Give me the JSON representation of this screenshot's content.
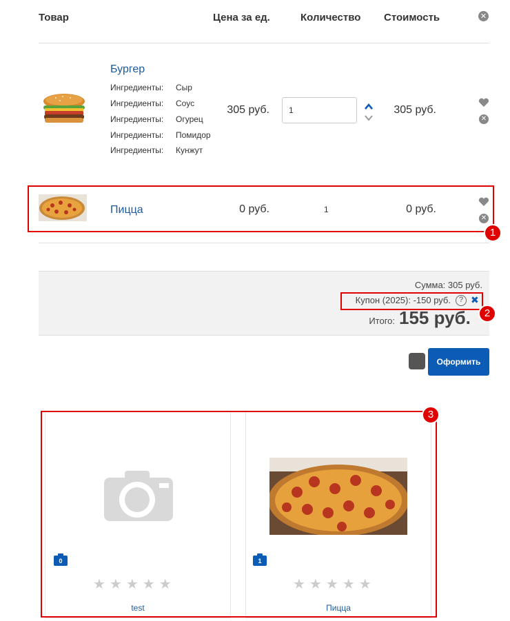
{
  "header": {
    "product": "Товар",
    "price_per_unit": "Цена за ед.",
    "quantity": "Количество",
    "cost": "Стоимость"
  },
  "items": [
    {
      "name": "Бургер",
      "ingredients": [
        {
          "label": "Ингредиенты:",
          "value": "Сыр"
        },
        {
          "label": "Ингредиенты:",
          "value": "Соус"
        },
        {
          "label": "Ингредиенты:",
          "value": "Огурец"
        },
        {
          "label": "Ингредиенты:",
          "value": "Помидор"
        },
        {
          "label": "Ингредиенты:",
          "value": "Кунжут"
        }
      ],
      "price": "305 руб.",
      "quantity": "1",
      "total": "305 руб."
    },
    {
      "name": "Пицца",
      "price": "0 руб.",
      "quantity": "1",
      "total": "0 руб."
    }
  ],
  "summary": {
    "sum": "Сумма: 305 руб.",
    "coupon": "Купон (2025): -150 руб.",
    "coupon_help": "?",
    "total_label": "Итого:",
    "total_value": "155 руб."
  },
  "checkout_button": "Оформить",
  "products": [
    {
      "name": "test",
      "cart_count": "0",
      "stars": "★★★★★"
    },
    {
      "name": "Пицца",
      "cart_count": "1",
      "stars": "★★★★★"
    }
  ],
  "annotations": [
    "1",
    "2",
    "3"
  ],
  "colors": {
    "accent": "#0c5cb5",
    "link": "#1a5a9e",
    "annotation_red": "#e00000"
  }
}
